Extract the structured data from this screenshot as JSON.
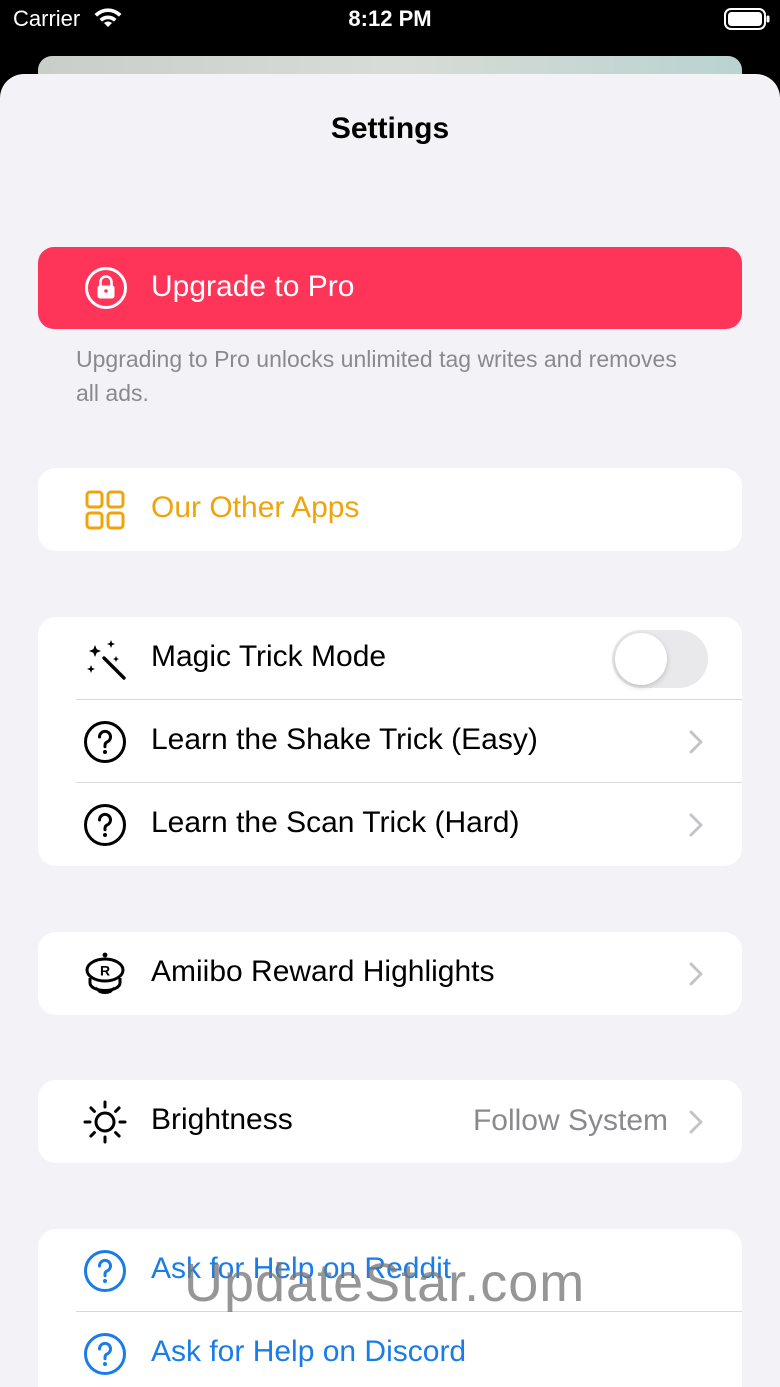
{
  "status_bar": {
    "carrier": "Carrier",
    "time": "8:12 PM"
  },
  "settings": {
    "title": "Settings",
    "upgrade": {
      "label": "Upgrade to Pro",
      "footnote": "Upgrading to Pro unlocks unlimited tag writes and removes all ads.",
      "color": "#fe3558"
    },
    "other_apps": {
      "label": "Our Other Apps",
      "color": "#f0a30a"
    },
    "magic_group": {
      "magic_trick": {
        "label": "Magic Trick Mode",
        "enabled": false
      },
      "shake_trick": {
        "label": "Learn the Shake Trick (Easy)"
      },
      "scan_trick": {
        "label": "Learn the Scan Trick (Hard)"
      }
    },
    "amiibo": {
      "label": "Amiibo Reward Highlights"
    },
    "brightness": {
      "label": "Brightness",
      "value": "Follow System"
    },
    "help_group": {
      "reddit": {
        "label": "Ask for Help on Reddit"
      },
      "discord": {
        "label": "Ask for Help on Discord"
      },
      "link_color": "#1a7ce8"
    }
  },
  "watermark": "UpdateStar.com"
}
